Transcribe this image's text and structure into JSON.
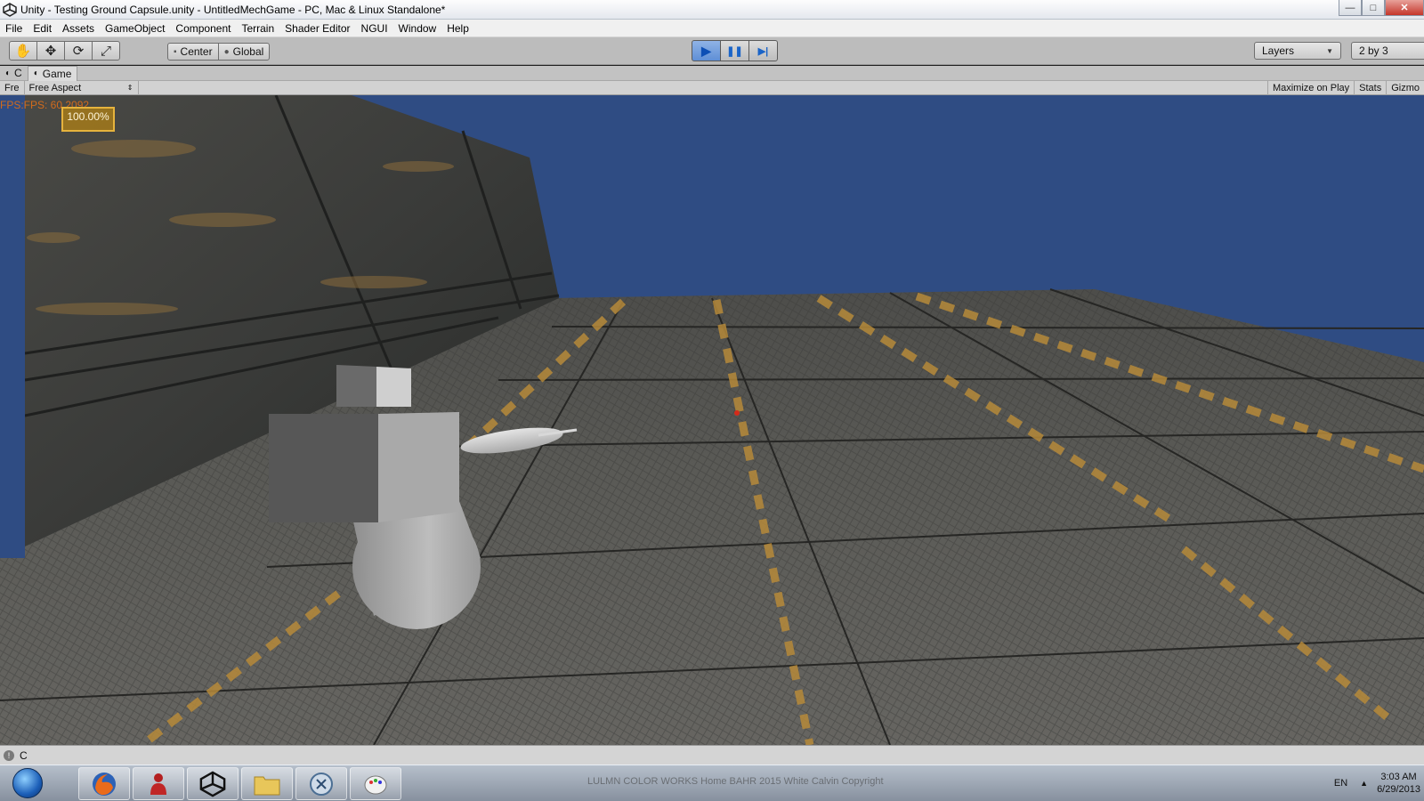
{
  "window": {
    "title": "Unity - Testing Ground Capsule.unity - UntitledMechGame - PC, Mac & Linux Standalone*",
    "minimize": "—",
    "maximize": "□",
    "close": "✕"
  },
  "menu": [
    "File",
    "Edit",
    "Assets",
    "GameObject",
    "Component",
    "Terrain",
    "Shader Editor",
    "NGUI",
    "Window",
    "Help"
  ],
  "toolbar": {
    "tools": [
      {
        "name": "hand-tool",
        "glyph": "✋"
      },
      {
        "name": "move-tool",
        "glyph": "✥"
      },
      {
        "name": "rotate-tool",
        "glyph": "⟳"
      },
      {
        "name": "scale-tool",
        "glyph": "⤢"
      }
    ],
    "pivot_center": "Center",
    "pivot_global": "Global",
    "play": "▶",
    "pause": "❚❚",
    "step": "▶|",
    "layers": "Layers",
    "layout": "2 by 3"
  },
  "tabs": {
    "collapsed": "C",
    "game": "Game"
  },
  "gamebar": {
    "free": "Fre",
    "aspect": "Free Aspect",
    "maximize_on_play": "Maximize on Play",
    "stats": "Stats",
    "gizmos": "Gizmo"
  },
  "viewport": {
    "fps": "FPS:FPS: 60.2092",
    "zoom": "100.00%"
  },
  "status": {
    "message": "C"
  },
  "taskbar": {
    "apps": [
      "windows-explorer",
      "firefox",
      "app-red",
      "unity",
      "file-explorer",
      "app-mouse",
      "paint"
    ],
    "background_text": "LULMN COLOR WORKS  Home BAHR 2015 White Calvin Copyright",
    "language": "EN",
    "time": "3:03 AM",
    "date": "6/29/2013"
  },
  "colors": {
    "sky": "#2f4c83",
    "fps": "#d26b1c",
    "zoom_border": "#e6b33d",
    "play_active": "#5f8fd6"
  }
}
